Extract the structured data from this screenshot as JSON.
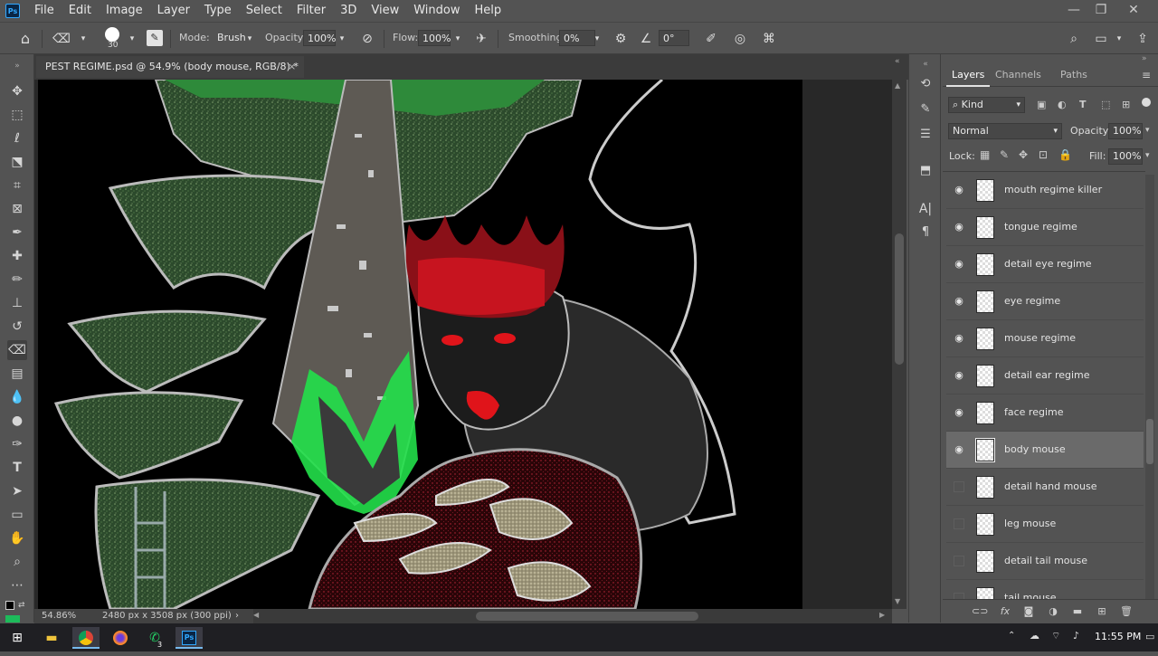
{
  "app": {
    "logo_text": "Ps"
  },
  "menubar": {
    "items": [
      "File",
      "Edit",
      "Image",
      "Layer",
      "Type",
      "Select",
      "Filter",
      "3D",
      "View",
      "Window",
      "Help"
    ]
  },
  "window_controls": {
    "minimize": "—",
    "restore": "❐",
    "close": "✕"
  },
  "options_bar": {
    "brush_size": "30",
    "mode_label": "Mode:",
    "mode_value": "Brush",
    "opacity_label": "Opacity:",
    "opacity_value": "100%",
    "flow_label": "Flow:",
    "flow_value": "100%",
    "smoothing_label": "Smoothing:",
    "smoothing_value": "0%",
    "angle_value": "0°"
  },
  "document": {
    "tab_title": "PEST REGIME.psd @ 54.9% (body mouse, RGB/8) *",
    "close_label": "×",
    "zoom": "54.86%",
    "dimensions": "2480 px x 3508 px (300 ppi)",
    "status_arrow": "›"
  },
  "panel": {
    "tabs": [
      "Layers",
      "Channels",
      "Paths"
    ],
    "filter_kind": "Kind",
    "blend_mode": "Normal",
    "opacity_label": "Opacity:",
    "opacity_value": "100%",
    "lock_label": "Lock:",
    "fill_label": "Fill:",
    "fill_value": "100%",
    "layers": [
      {
        "name": "mouth regime killer",
        "visible": true
      },
      {
        "name": "tongue regime",
        "visible": true
      },
      {
        "name": "detail eye regime",
        "visible": true
      },
      {
        "name": "eye regime",
        "visible": true
      },
      {
        "name": "mouse regime",
        "visible": true
      },
      {
        "name": "detail ear regime",
        "visible": true
      },
      {
        "name": "face regime",
        "visible": true
      },
      {
        "name": "body mouse",
        "visible": true,
        "selected": true
      },
      {
        "name": "detail hand mouse",
        "visible": false
      },
      {
        "name": "leg mouse",
        "visible": false
      },
      {
        "name": "detail tail mouse",
        "visible": false
      },
      {
        "name": "tail mouse",
        "visible": false
      }
    ],
    "footer_icons": [
      "link-icon",
      "fx-icon",
      "mask-icon",
      "adjustment-icon",
      "folder-icon",
      "new-layer-icon",
      "trash-icon"
    ]
  },
  "taskbar": {
    "clock": "11:55 PM",
    "apps": [
      "file-explorer",
      "chrome",
      "firefox",
      "whatsapp",
      "photoshop"
    ],
    "whatsapp_badge": "3"
  },
  "colors": {
    "ui_bg": "#535353",
    "canvas_bg": "#282828",
    "artwork_bg": "#000000",
    "selected_layer": "#6a6a6a",
    "accent_green": "#22e04a",
    "accent_red": "#e0141a"
  }
}
